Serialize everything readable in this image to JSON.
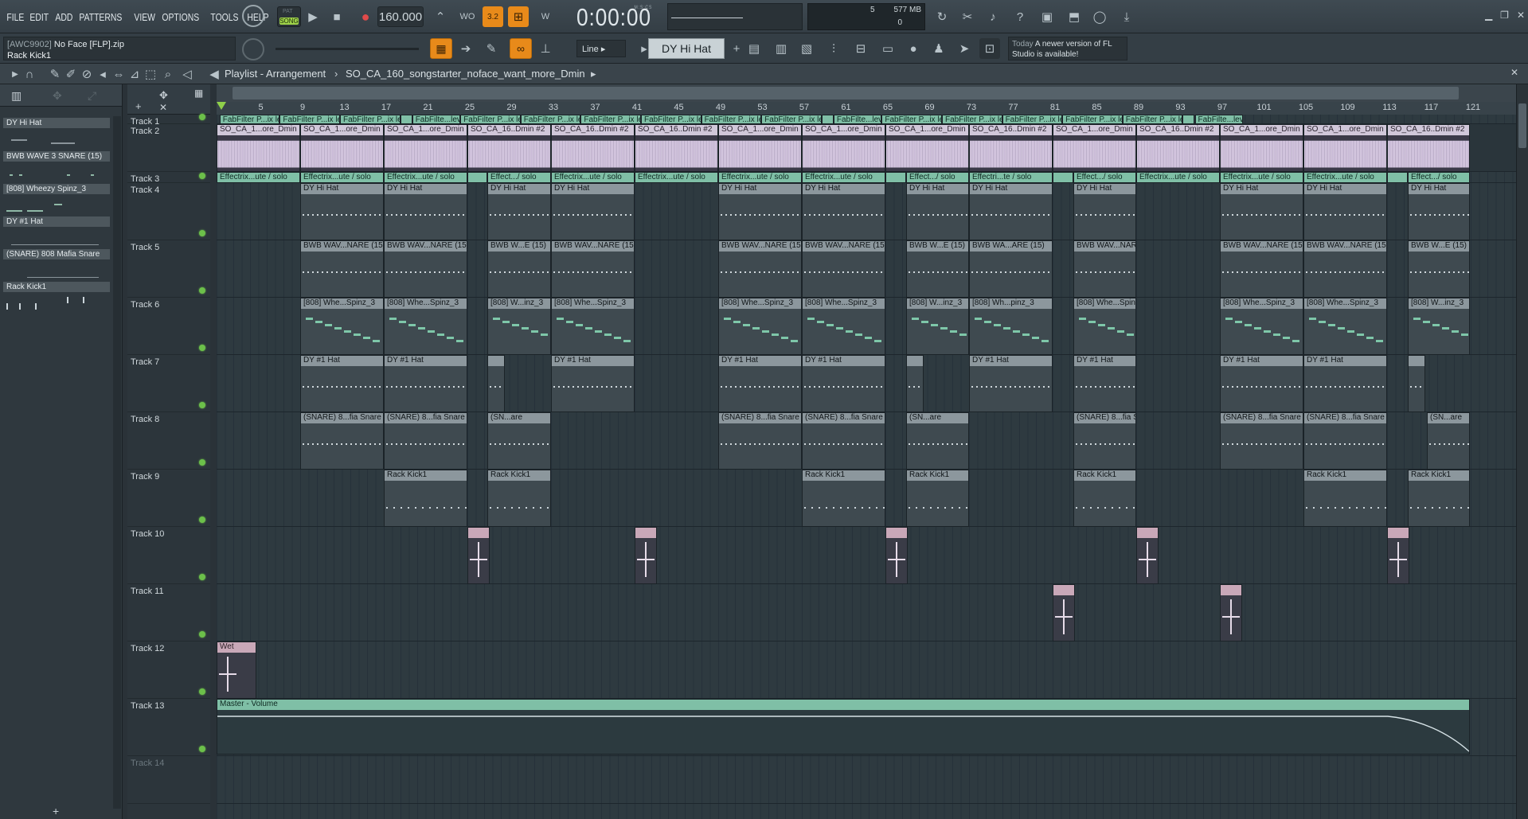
{
  "menu": [
    "FILE",
    "EDIT",
    "ADD",
    "PATTERNS",
    "VIEW",
    "OPTIONS",
    "TOOLS",
    "HELP"
  ],
  "transport": {
    "pat_label": "PAT",
    "song_label": "SONG",
    "tempo": "160.000",
    "time": "0:00:00",
    "time_unit": "M:S:CS"
  },
  "cpu": {
    "mem": "577 MB",
    "voices": "5",
    "zero": "0"
  },
  "project": {
    "folder": "[AWC9902]",
    "name": "No Face [FLP].zip",
    "channel": "Rack Kick1"
  },
  "snap": {
    "mode": "Line"
  },
  "channel_selector": {
    "value": "DY Hi Hat"
  },
  "news": {
    "when": "Today",
    "text": "A newer version of FL Studio is available!"
  },
  "playlist": {
    "title": "Playlist - Arrangement",
    "separator": "›",
    "pattern": "SO_CA_160_songstarter_noface_want_more_Dmin"
  },
  "picker": [
    "DY Hi Hat",
    "BWB WAVE 3 SNARE (15)",
    "[808] Wheezy Spinz_3",
    "DY #1 Hat",
    "(SNARE) 808 Mafia Snare",
    "Rack Kick1"
  ],
  "ruler": [
    "5",
    "9",
    "13",
    "17",
    "21",
    "25",
    "29",
    "33",
    "37",
    "41",
    "45",
    "49",
    "53",
    "57",
    "61",
    "65",
    "69",
    "73",
    "77",
    "81",
    "85",
    "89",
    "93",
    "97",
    "101",
    "105",
    "109",
    "113",
    "117",
    "121"
  ],
  "tracks": [
    "Track 1",
    "Track 2",
    "Track 3",
    "Track 4",
    "Track 5",
    "Track 6",
    "Track 7",
    "Track 8",
    "Track 9",
    "Track 10",
    "Track 11",
    "Track 12",
    "Track 13",
    "Track 14"
  ],
  "clip_names": {
    "t1a": "FabFilter P...ix level",
    "t1b": "FabFilte...level",
    "t2a": "SO_CA_1...ore_Dmin",
    "t2b": "SO_CA_16..Dmin #2",
    "t3a": "Effectrix...ute / solo",
    "t3b": "Effect.../ solo",
    "t3c": "Effectri...te / solo",
    "hat": "DY Hi Hat",
    "snare": "BWB WAV...NARE (15)",
    "snare_s": "BWB W...E (15)",
    "snare_s2": "BWB WA...ARE (15)",
    "s808": "[808] Whe...Spinz_3",
    "s808_s": "[808] W...inz_3",
    "s808_s2": "[808] Wh...pinz_3",
    "hat1": "DY #1 Hat",
    "mafia": "(SNARE) 8...fia Snare",
    "mafia_s": "(SN...are",
    "kick": "Rack Kick1",
    "wet": "Wet",
    "master": "Master - Volume"
  }
}
